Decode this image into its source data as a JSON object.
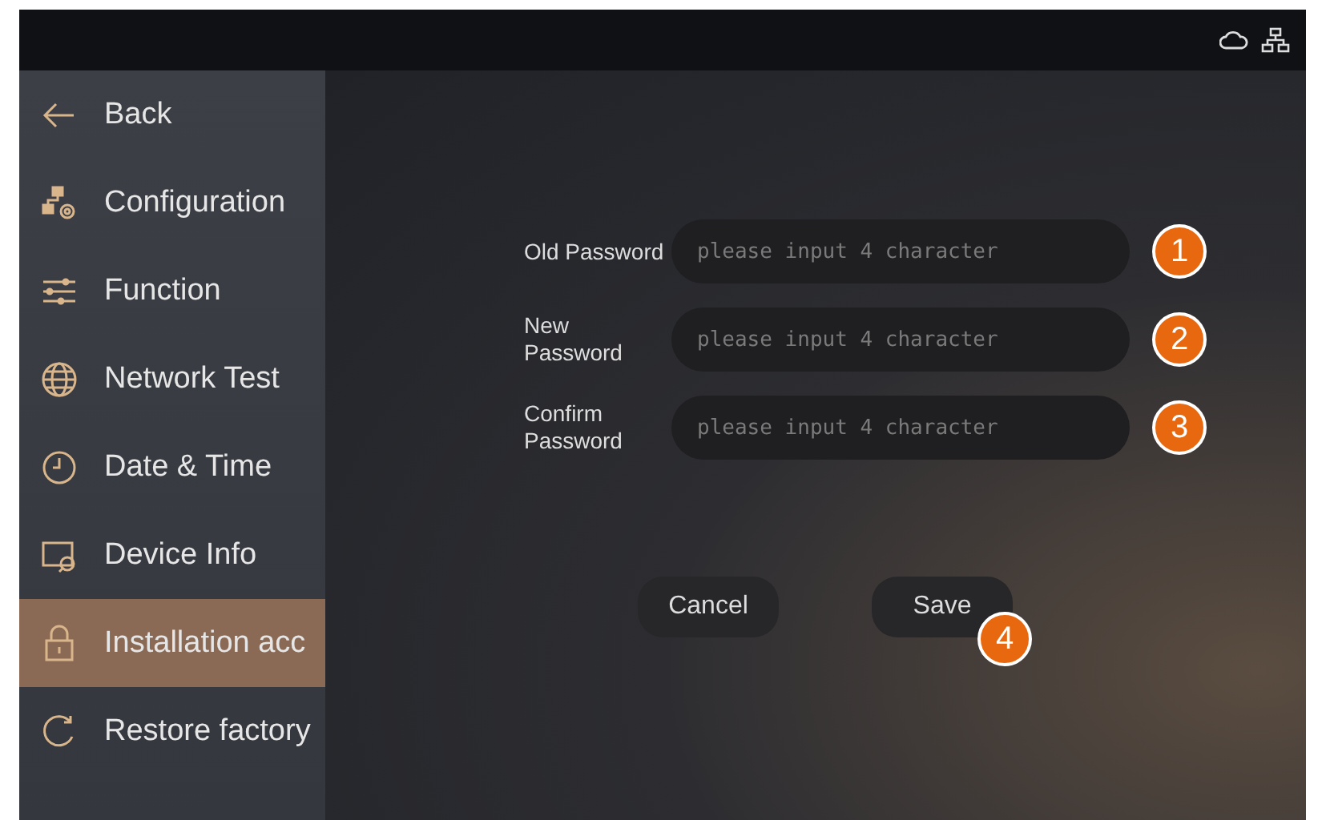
{
  "sidebar": {
    "items": [
      {
        "label": "Back",
        "selected": false
      },
      {
        "label": "Configuration",
        "selected": false
      },
      {
        "label": "Function",
        "selected": false
      },
      {
        "label": "Network Test",
        "selected": false
      },
      {
        "label": "Date & Time",
        "selected": false
      },
      {
        "label": "Device Info",
        "selected": false
      },
      {
        "label": "Installation acc",
        "selected": true
      },
      {
        "label": "Restore factory",
        "selected": false
      }
    ]
  },
  "form": {
    "fields": [
      {
        "label": "Old Password",
        "placeholder": "please input 4 character",
        "badge": "1"
      },
      {
        "label": "New Password",
        "placeholder": "please input 4 character",
        "badge": "2"
      },
      {
        "label": "Confirm Password",
        "placeholder": "please input 4 character",
        "badge": "3"
      }
    ],
    "buttons": [
      {
        "label": "Cancel"
      },
      {
        "label": "Save",
        "badge": "4"
      }
    ]
  }
}
